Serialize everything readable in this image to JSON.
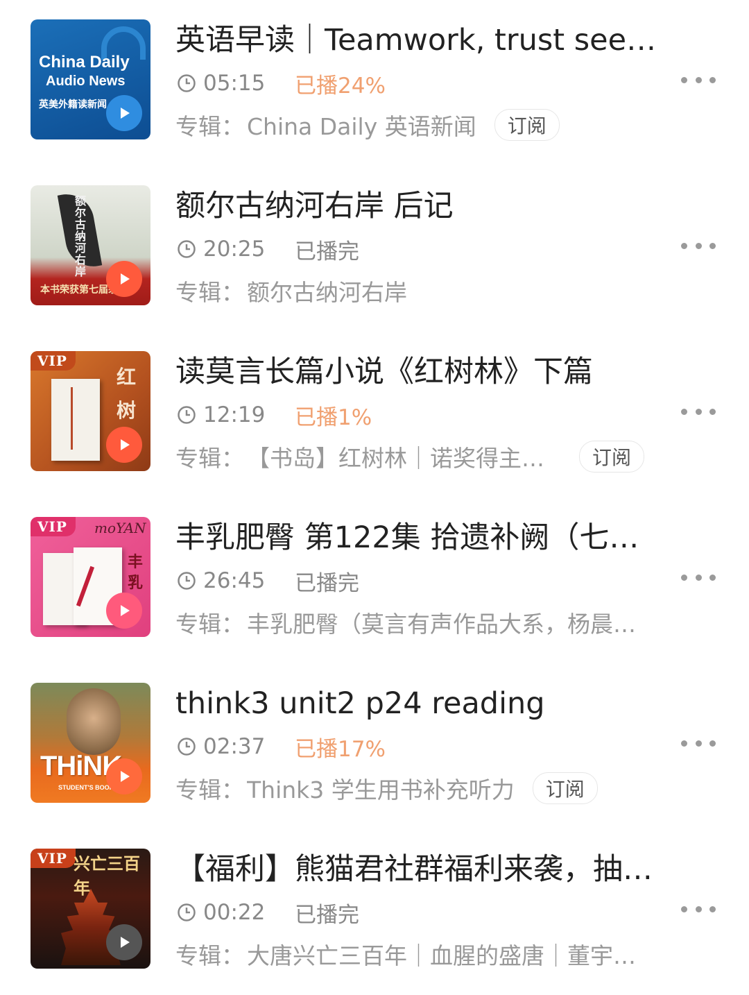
{
  "colors": {
    "progress_partial": "#f0a070",
    "text_muted": "#888888",
    "title": "#222222"
  },
  "items": [
    {
      "title": "英语早读｜Teamwork, trust seen…",
      "duration": "05:15",
      "progress": "已播24%",
      "progress_partial": true,
      "album_label": "专辑：",
      "album": "China Daily 英语新闻",
      "subscribe": "订阅",
      "cover": {
        "line1": "China Daily",
        "line2": "Audio News",
        "line3": "英美外籍读新闻"
      }
    },
    {
      "title": "额尔古纳河右岸 后记",
      "duration": "20:25",
      "progress": "已播完",
      "progress_partial": false,
      "album_label": "专辑：",
      "album": "额尔古纳河右岸",
      "subscribe": "",
      "cover": {
        "vertical": "额尔古纳河右岸",
        "band": "本书荣获第七届茅盾"
      }
    },
    {
      "title": "读莫言长篇小说《红树林》下篇",
      "duration": "12:19",
      "progress": "已播1%",
      "progress_partial": true,
      "album_label": "专辑：",
      "album": "【书岛】红树林｜诺奖得主…",
      "subscribe": "订阅",
      "cover": {
        "vip": "VIP",
        "chars": "红树"
      }
    },
    {
      "title": "丰乳肥臀 第122集 拾遗补阙（七…",
      "duration": "26:45",
      "progress": "已播完",
      "progress_partial": false,
      "album_label": "专辑：",
      "album": "丰乳肥臀（莫言有声作品大系，杨晨…",
      "subscribe": "",
      "cover": {
        "vip": "VIP",
        "brand": "moYAN",
        "chars": "丰乳"
      }
    },
    {
      "title": "think3 unit2 p24 reading",
      "duration": "02:37",
      "progress": "已播17%",
      "progress_partial": true,
      "album_label": "专辑：",
      "album": "Think3 学生用书补充听力",
      "subscribe": "订阅",
      "cover": {
        "word": "THiNK",
        "sub": "STUDENT'S BOOK"
      }
    },
    {
      "title": "【福利】熊猫君社群福利来袭，抽…",
      "duration": "00:22",
      "progress": "已播完",
      "progress_partial": false,
      "album_label": "专辑：",
      "album": "大唐兴亡三百年｜血腥的盛唐｜董宇…",
      "subscribe": "",
      "cover": {
        "vip": "VIP",
        "banner": "兴亡三百年"
      }
    }
  ]
}
